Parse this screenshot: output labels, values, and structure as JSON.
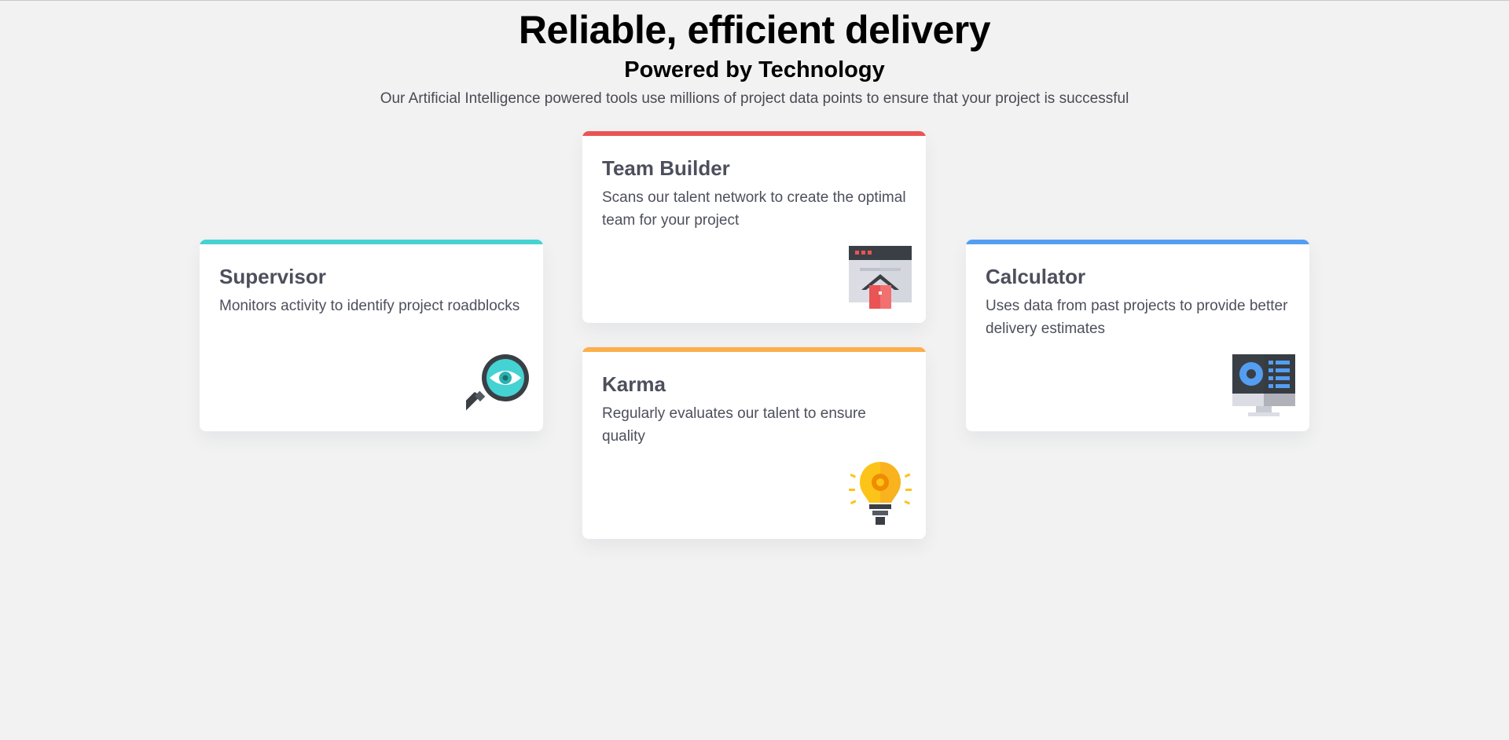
{
  "header": {
    "title": "Reliable, efficient delivery",
    "subtitle": "Powered by Technology",
    "description": "Our Artificial Intelligence powered tools use millions of project data points to ensure that your project is successful"
  },
  "cards": [
    {
      "id": "supervisor",
      "title": "Supervisor",
      "description": "Monitors activity to identify project roadblocks",
      "accent": "#44d3d2",
      "icon": "magnifying-glass-eye-icon"
    },
    {
      "id": "team-builder",
      "title": "Team Builder",
      "description": "Scans our talent network to create the optimal team for your project",
      "accent": "#ea5454",
      "icon": "browser-home-icon"
    },
    {
      "id": "karma",
      "title": "Karma",
      "description": "Regularly evaluates our talent to ensure quality",
      "accent": "#fcaf4a",
      "icon": "lightbulb-gear-icon"
    },
    {
      "id": "calculator",
      "title": "Calculator",
      "description": "Uses data from past projects to provide better delivery estimates",
      "accent": "#549ef2",
      "icon": "monitor-chart-icon"
    }
  ],
  "colors": {
    "background": "#f2f2f2",
    "card_text": "#4d4f5c",
    "heading": "#000000"
  }
}
